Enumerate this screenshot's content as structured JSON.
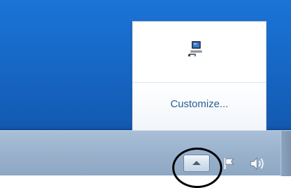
{
  "notification_overflow": {
    "icons": [
      {
        "name": "network-computer-icon"
      }
    ],
    "customize_label": "Customize..."
  },
  "taskbar": {
    "tray_icons": [
      "show-hidden-icons-arrow-icon",
      "action-center-flag-icon",
      "volume-speaker-icon"
    ]
  },
  "colors": {
    "desktop_blue": "#1666c4",
    "link_blue": "#2a5d95",
    "taskbar": "#9bb3cd",
    "highlight_circle": "#000000"
  }
}
